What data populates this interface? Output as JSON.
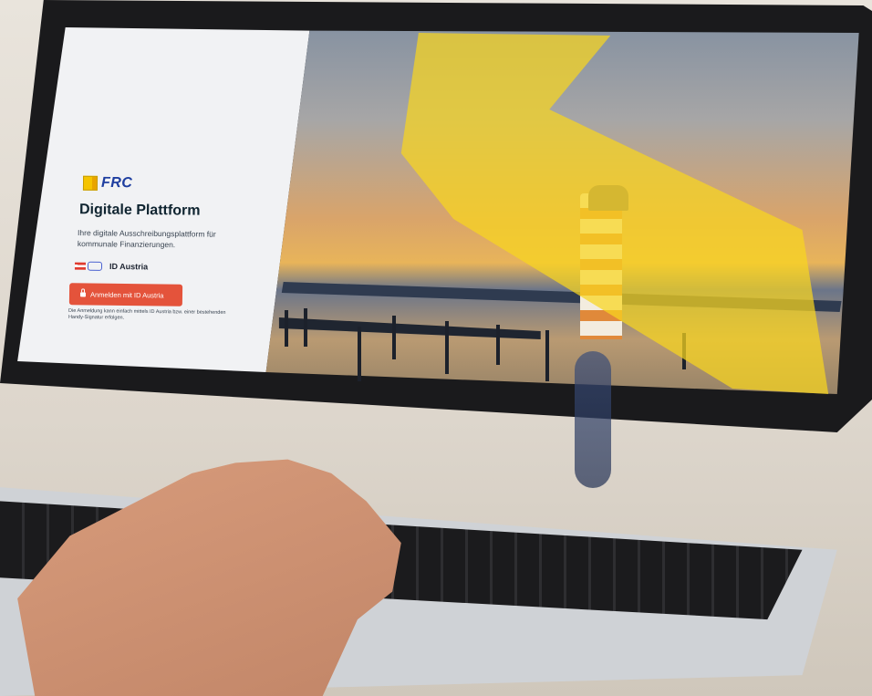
{
  "screen": {
    "brand": {
      "icon": "frc-logo-icon",
      "name": "FRC"
    },
    "title": "Digitale Plattform",
    "subtitle": "Ihre digitale Ausschreibungsplattform für kommunale Finanzierungen.",
    "id_austria": {
      "icon": "id-austria-logo-icon",
      "label": "ID Austria"
    },
    "login_button": {
      "icon": "lock-icon",
      "label": "Anmelden mit ID Austria"
    },
    "note": "Die Anmeldung kann einfach mittels ID Austria bzw. einer bestehenden Handy-Signatur erfolgen.",
    "accent_colors": {
      "brand_yellow": "#F5C400",
      "brand_blue": "#1F3FA0",
      "button_red": "#E4533B"
    }
  }
}
